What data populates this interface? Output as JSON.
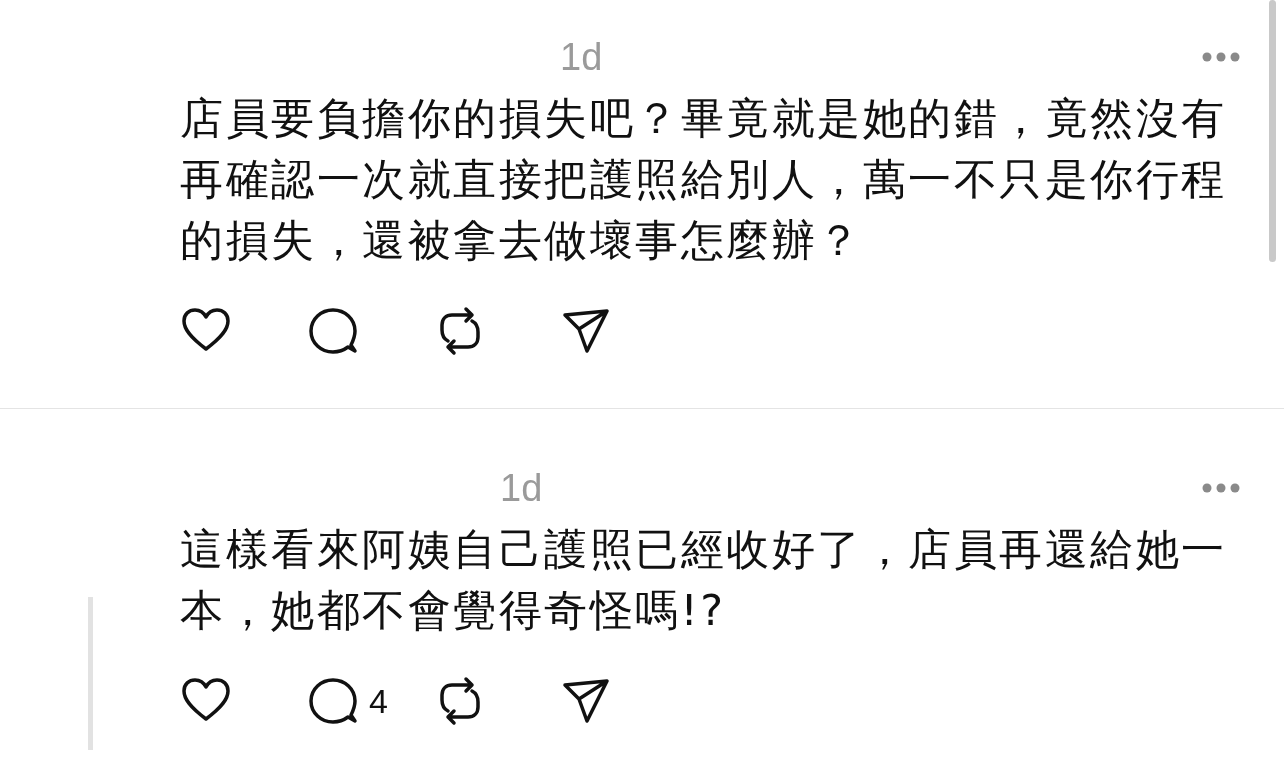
{
  "posts": [
    {
      "time": "1d",
      "text": "店員要負擔你的損失吧？畢竟就是她的錯，竟然沒有再確認一次就直接把護照給別人，萬一不只是你行程的損失，還被拿去做壞事怎麼辦？",
      "thread_line": false
    },
    {
      "time": "1d",
      "text": "這樣看來阿姨自己護照已經收好了，店員再還給她一本，她都不會覺得奇怪嗎!?",
      "thread_line": true,
      "reply_count": "4"
    }
  ]
}
